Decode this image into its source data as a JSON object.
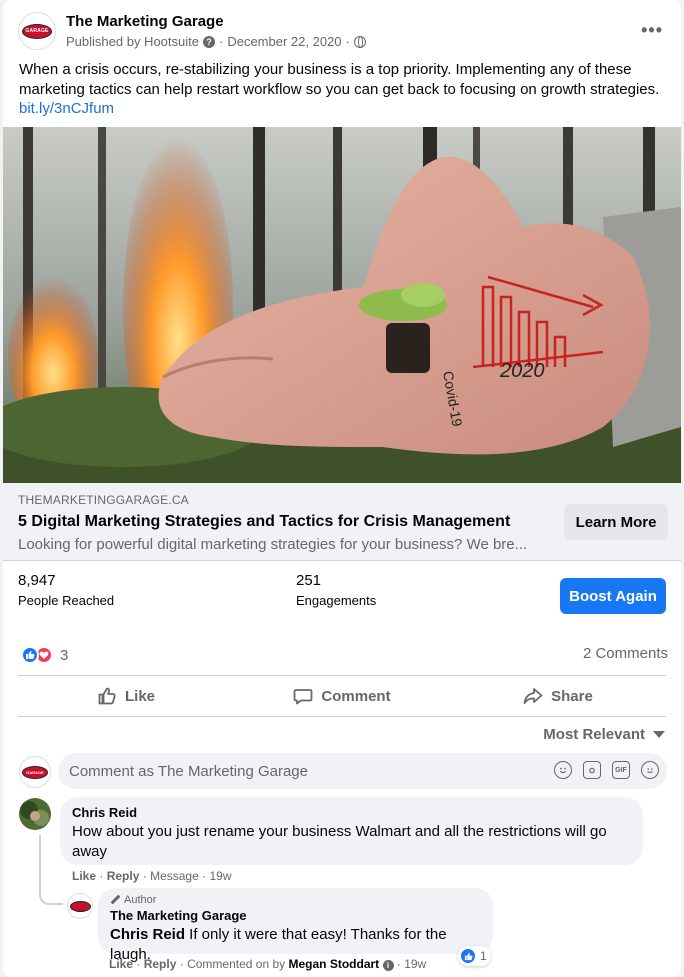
{
  "post": {
    "page_name": "The Marketing Garage",
    "publisher": "Published by Hootsuite",
    "help_glyph": "?",
    "separator": "·",
    "date": "December 22, 2020",
    "options": "•••",
    "text": "When a crisis occurs, re-stabilizing your business is a top priority. Implementing any of these marketing tactics can help restart workflow so you can get back to focusing on growth strategies. ",
    "link_text": "bit.ly/3nCJfum",
    "logo_text": "GARAGE"
  },
  "image": {
    "annotation_1": "Covid-19",
    "annotation_2": "2020"
  },
  "link_preview": {
    "domain": "THEMARKETINGGARAGE.CA",
    "title": "5 Digital Marketing Strategies and Tactics for Crisis Management",
    "description": "Looking for powerful digital marketing strategies for your business? We bre...",
    "button": "Learn More"
  },
  "insights": {
    "reached_value": "8,947",
    "reached_label": "People Reached",
    "engagements_value": "251",
    "engagements_label": "Engagements",
    "boost_button": "Boost Again"
  },
  "reactions": {
    "count": "3",
    "comments": "2 Comments"
  },
  "actions": {
    "like": "Like",
    "comment": "Comment",
    "share": "Share"
  },
  "sort": {
    "label": "Most Relevant"
  },
  "composer": {
    "placeholder": "Comment as The Marketing Garage",
    "gif_label": "GIF"
  },
  "comments": [
    {
      "author": "Chris Reid",
      "text": "How about you just rename your business Walmart and all the restrictions will go away",
      "like": "Like",
      "reply": "Reply",
      "sep": "·",
      "message": "Message",
      "time": "19w"
    }
  ],
  "reply": {
    "tag": "Author",
    "author": "The Marketing Garage",
    "mention": "Chris Reid",
    "text": " If only it were that easy! Thanks for the laugh.",
    "like": "Like",
    "reply": "Reply",
    "sep": "·",
    "commented_on_by": "Commented on by",
    "commenter": "Megan Stoddart",
    "info_glyph": "i",
    "time": "19w",
    "like_count": "1"
  },
  "colors": {
    "accent": "#1877f2",
    "love": "#f33e58",
    "link": "#216fdb",
    "muted": "#65676b",
    "brand_red": "#c8102e"
  },
  "icons": [
    "globe-icon",
    "help-icon",
    "more-icon",
    "thumbs-up-icon",
    "heart-icon",
    "comment-icon",
    "share-icon",
    "caret-down-icon",
    "emoji-icon",
    "camera-icon",
    "gif-icon",
    "sticker-icon",
    "pen-icon",
    "info-icon"
  ]
}
